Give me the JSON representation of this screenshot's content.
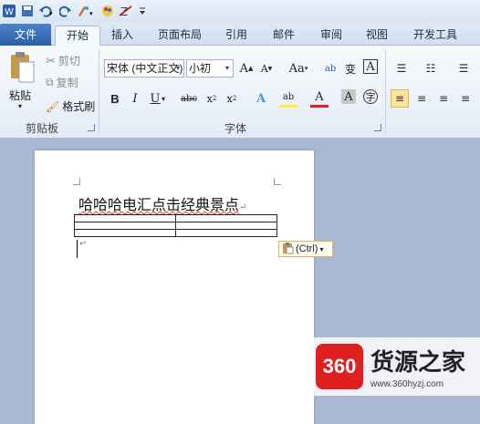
{
  "tabs": {
    "file": "文件",
    "items": [
      "开始",
      "插入",
      "页面布局",
      "引用",
      "邮件",
      "审阅",
      "视图",
      "开发工具"
    ]
  },
  "clipboard": {
    "paste": "粘贴",
    "cut": "剪切",
    "copy": "复制",
    "format_painter": "格式刷",
    "group_label": "剪贴板"
  },
  "font": {
    "name": "宋体 (中文正文)",
    "size": "小初",
    "group_label": "字体"
  },
  "document": {
    "heading": "哈哈哈电汇点击经典景点",
    "paste_options": "(Ctrl)"
  },
  "watermark": {
    "logo": "360",
    "name": "货源之家",
    "url": "www.360hyzj.com"
  },
  "colors": {
    "file_tab": "#2a5fa8",
    "highlight": "#ffee33",
    "font_color": "#e02020",
    "watermark_logo": "#e02020"
  }
}
